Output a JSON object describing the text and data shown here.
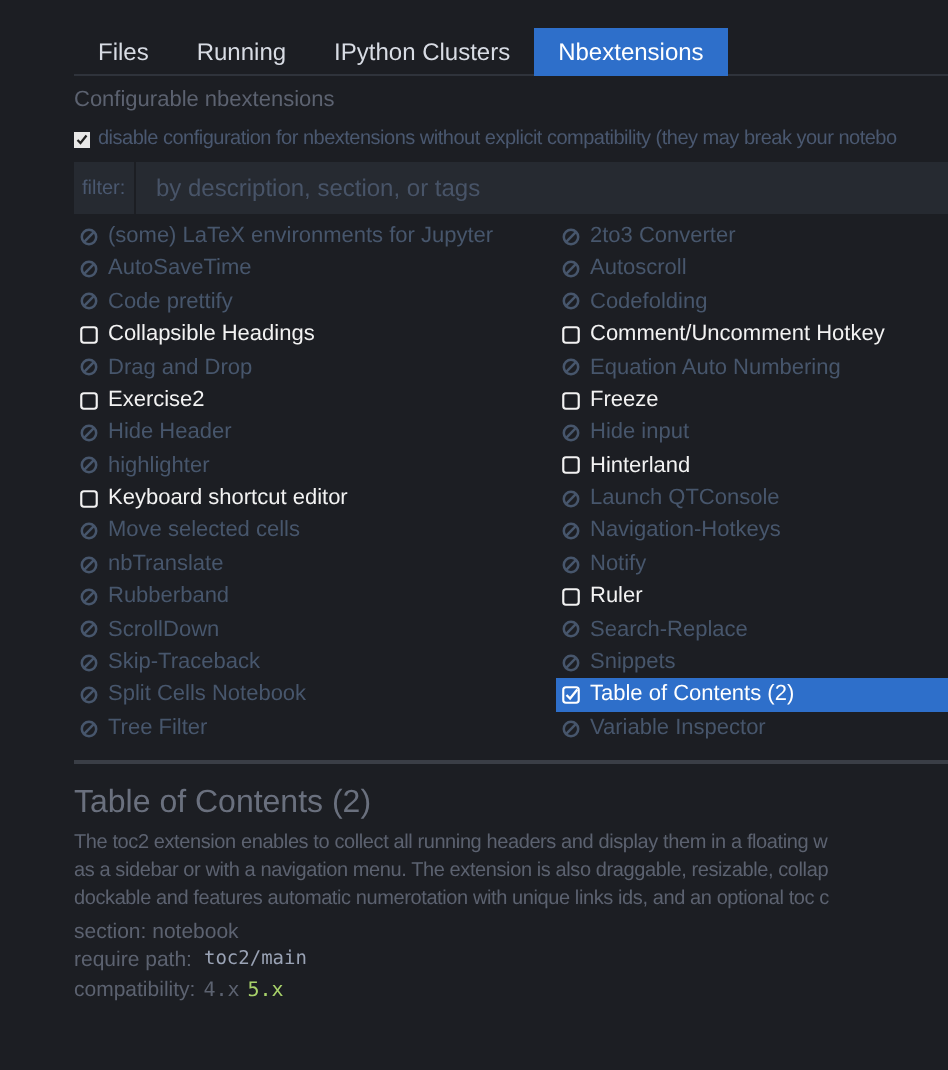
{
  "tabs": [
    {
      "label": "Files",
      "selected": false
    },
    {
      "label": "Running",
      "selected": false
    },
    {
      "label": "IPython Clusters",
      "selected": false
    },
    {
      "label": "Nbextensions",
      "selected": true
    }
  ],
  "heading": "Configurable nbextensions",
  "compat_option": {
    "label": "disable configuration for nbextensions without explicit compatibility (they may break your notebo",
    "checked": true
  },
  "filter": {
    "label": "filter:",
    "placeholder": "by description, section, or tags"
  },
  "extensions": [
    {
      "label": "(some) LaTeX environments for Jupyter",
      "kind": "incompatible",
      "selected": false
    },
    {
      "label": "2to3 Converter",
      "kind": "incompatible",
      "selected": false
    },
    {
      "label": "AutoSaveTime",
      "kind": "incompatible",
      "selected": false
    },
    {
      "label": "Autoscroll",
      "kind": "incompatible",
      "selected": false
    },
    {
      "label": "Code prettify",
      "kind": "incompatible",
      "selected": false
    },
    {
      "label": "Codefolding",
      "kind": "incompatible",
      "selected": false
    },
    {
      "label": "Collapsible Headings",
      "kind": "unchecked",
      "selected": false
    },
    {
      "label": "Comment/Uncomment Hotkey",
      "kind": "unchecked",
      "selected": false
    },
    {
      "label": "Drag and Drop",
      "kind": "incompatible",
      "selected": false
    },
    {
      "label": "Equation Auto Numbering",
      "kind": "incompatible",
      "selected": false
    },
    {
      "label": "Exercise2",
      "kind": "unchecked",
      "selected": false
    },
    {
      "label": "Freeze",
      "kind": "unchecked",
      "selected": false
    },
    {
      "label": "Hide Header",
      "kind": "incompatible",
      "selected": false
    },
    {
      "label": "Hide input",
      "kind": "incompatible",
      "selected": false
    },
    {
      "label": "highlighter",
      "kind": "incompatible",
      "selected": false
    },
    {
      "label": "Hinterland",
      "kind": "unchecked",
      "selected": false
    },
    {
      "label": "Keyboard shortcut editor",
      "kind": "unchecked",
      "selected": false
    },
    {
      "label": "Launch QTConsole",
      "kind": "incompatible",
      "selected": false
    },
    {
      "label": "Move selected cells",
      "kind": "incompatible",
      "selected": false
    },
    {
      "label": "Navigation-Hotkeys",
      "kind": "incompatible",
      "selected": false
    },
    {
      "label": "nbTranslate",
      "kind": "incompatible",
      "selected": false
    },
    {
      "label": "Notify",
      "kind": "incompatible",
      "selected": false
    },
    {
      "label": "Rubberband",
      "kind": "incompatible",
      "selected": false
    },
    {
      "label": "Ruler",
      "kind": "unchecked",
      "selected": false
    },
    {
      "label": "ScrollDown",
      "kind": "incompatible",
      "selected": false
    },
    {
      "label": "Search-Replace",
      "kind": "incompatible",
      "selected": false
    },
    {
      "label": "Skip-Traceback",
      "kind": "incompatible",
      "selected": false
    },
    {
      "label": "Snippets",
      "kind": "incompatible",
      "selected": false
    },
    {
      "label": "Split Cells Notebook",
      "kind": "incompatible",
      "selected": false
    },
    {
      "label": "Table of Contents (2)",
      "kind": "checked",
      "selected": true
    },
    {
      "label": "Tree Filter",
      "kind": "incompatible",
      "selected": false
    },
    {
      "label": "Variable Inspector",
      "kind": "incompatible",
      "selected": false
    }
  ],
  "details": {
    "title": "Table of Contents (2)",
    "description": [
      "The toc2 extension enables to collect all running headers and display them in a floating w",
      "as a sidebar or with a navigation menu. The extension is also draggable, resizable, collap",
      "dockable and features automatic numerotation with unique links ids, and an optional toc c"
    ],
    "section": "section: notebook",
    "require_label": "require path:",
    "require_path": "toc2/main",
    "compat_label": "compatibility:",
    "compatibility": [
      {
        "label": "4.x",
        "supported": false
      },
      {
        "label": "5.x",
        "supported": true
      }
    ]
  }
}
